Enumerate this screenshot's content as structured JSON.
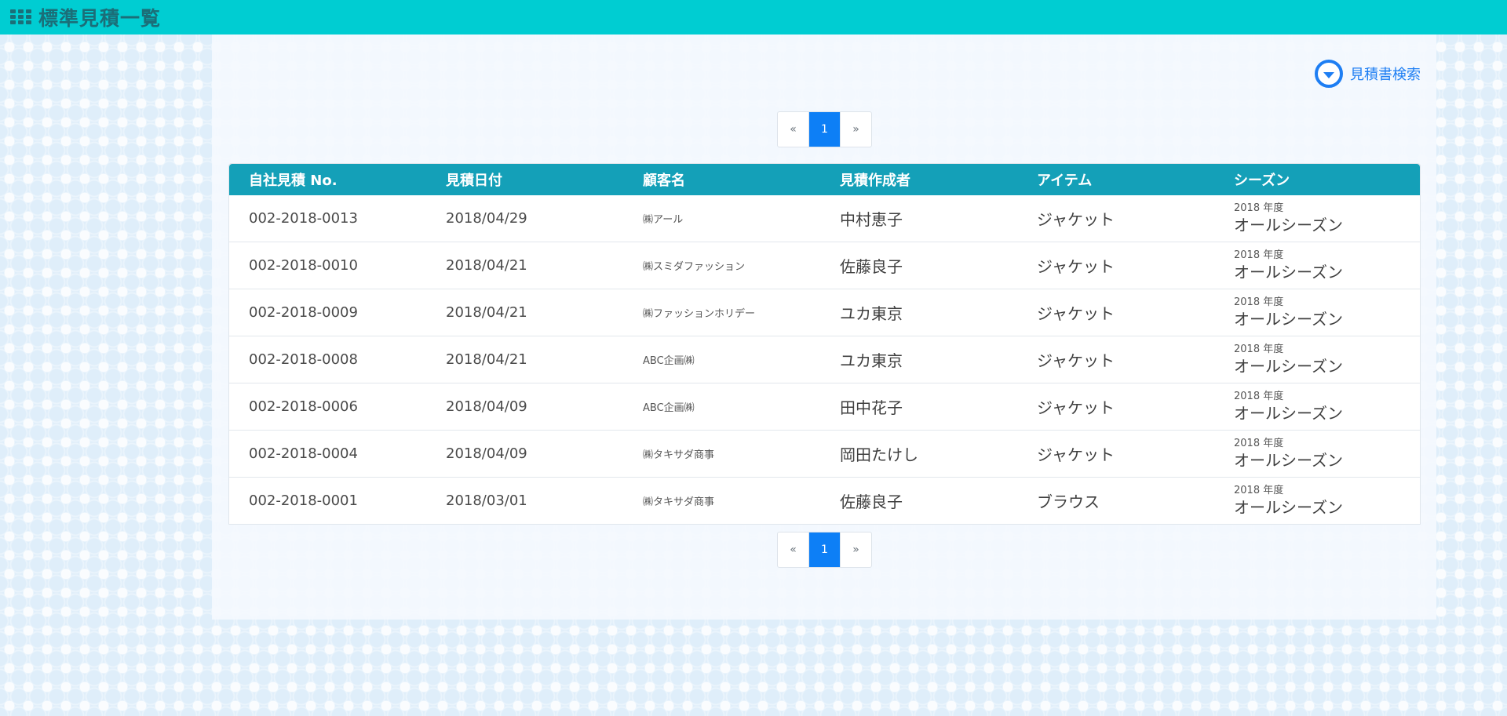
{
  "app": {
    "title": "標準見積一覧"
  },
  "search": {
    "toggle_label": "見積書検索"
  },
  "pagination": {
    "prev": "«",
    "current": "1",
    "next": "»"
  },
  "table": {
    "headers": [
      "自社見積 No.",
      "見積日付",
      "顧客名",
      "見積作成者",
      "アイテム",
      "シーズン"
    ],
    "rows": [
      {
        "no": "002-2018-0013",
        "date": "2018/04/29",
        "customer": "㈱アール",
        "author": "中村恵子",
        "item": "ジャケット",
        "season_year": "2018 年度",
        "season": "オールシーズン"
      },
      {
        "no": "002-2018-0010",
        "date": "2018/04/21",
        "customer": "㈱スミダファッション",
        "author": "佐藤良子",
        "item": "ジャケット",
        "season_year": "2018 年度",
        "season": "オールシーズン"
      },
      {
        "no": "002-2018-0009",
        "date": "2018/04/21",
        "customer": "㈱ファッションホリデー",
        "author": "ユカ東京",
        "item": "ジャケット",
        "season_year": "2018 年度",
        "season": "オールシーズン"
      },
      {
        "no": "002-2018-0008",
        "date": "2018/04/21",
        "customer": "ABC企画㈱",
        "author": "ユカ東京",
        "item": "ジャケット",
        "season_year": "2018 年度",
        "season": "オールシーズン"
      },
      {
        "no": "002-2018-0006",
        "date": "2018/04/09",
        "customer": "ABC企画㈱",
        "author": "田中花子",
        "item": "ジャケット",
        "season_year": "2018 年度",
        "season": "オールシーズン"
      },
      {
        "no": "002-2018-0004",
        "date": "2018/04/09",
        "customer": "㈱タキサダ商事",
        "author": "岡田たけし",
        "item": "ジャケット",
        "season_year": "2018 年度",
        "season": "オールシーズン"
      },
      {
        "no": "002-2018-0001",
        "date": "2018/03/01",
        "customer": "㈱タキサダ商事",
        "author": "佐藤良子",
        "item": "ブラウス",
        "season_year": "2018 年度",
        "season": "オールシーズン"
      }
    ]
  },
  "colors": {
    "topbar": "#00cdd2",
    "table_header": "#14a0b8",
    "accent": "#0d7ff6"
  },
  "icons": {
    "menu": "grid-icon",
    "search_toggle": "chevron-down-circle-icon"
  }
}
